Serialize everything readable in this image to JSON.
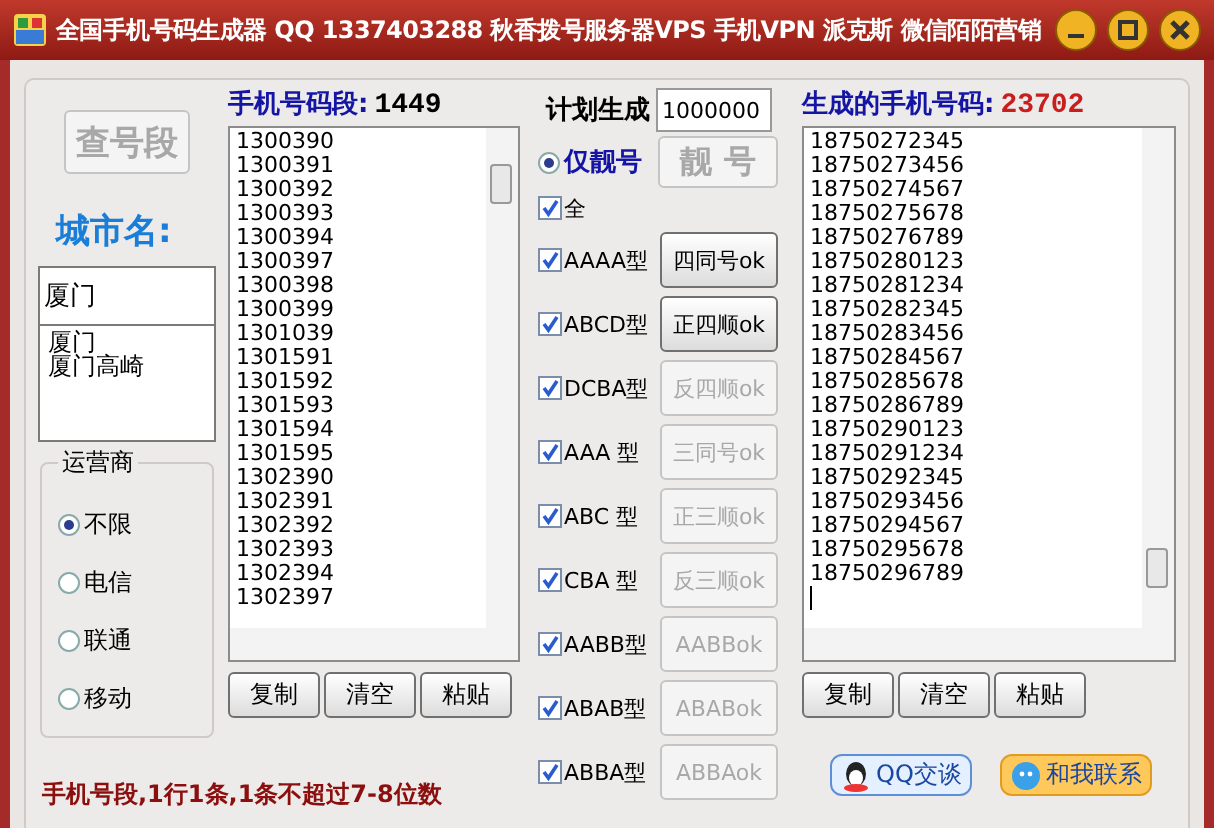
{
  "window": {
    "title": "全国手机号码生成器 QQ 1337403288 秋香拨号服务器VPS 手机VPN 派克斯 微信陌陌营销"
  },
  "lookup_button": {
    "label": "查号段",
    "disabled": true
  },
  "city": {
    "label": "城市名:",
    "value": "厦门",
    "suggestions": [
      "厦门",
      "厦门高崎"
    ]
  },
  "carrier": {
    "title": "运营商",
    "options": [
      {
        "label": "不限",
        "selected": true
      },
      {
        "label": "电信",
        "selected": false
      },
      {
        "label": "联通",
        "selected": false
      },
      {
        "label": "移动",
        "selected": false
      }
    ]
  },
  "segments": {
    "label": "手机号码段:",
    "count": "1449",
    "items": [
      "1300390",
      "1300391",
      "1300392",
      "1300393",
      "1300394",
      "1300397",
      "1300398",
      "1300399",
      "1301039",
      "1301591",
      "1301592",
      "1301593",
      "1301594",
      "1301595",
      "1302390",
      "1302391",
      "1302392",
      "1302393",
      "1302394",
      "1302397"
    ],
    "buttons": [
      "复制",
      "清空",
      "粘贴"
    ]
  },
  "note": "手机号段,1行1条,1条不超过7-8位数",
  "plan": {
    "label": "计划生成",
    "value": "1000000"
  },
  "pretty_only": {
    "label": "仅靓号",
    "selected": true
  },
  "pretty_button": {
    "label": "靓 号",
    "disabled": true
  },
  "patterns": [
    {
      "label": "全",
      "checked": true
    },
    {
      "label": "AAAA型",
      "checked": true,
      "button": {
        "label": "四同号ok",
        "disabled": false
      }
    },
    {
      "label": "ABCD型",
      "checked": true,
      "button": {
        "label": "正四顺ok",
        "disabled": false
      }
    },
    {
      "label": "DCBA型",
      "checked": true,
      "button": {
        "label": "反四顺ok",
        "disabled": true
      }
    },
    {
      "label": "AAA 型",
      "checked": true,
      "button": {
        "label": "三同号ok",
        "disabled": true
      }
    },
    {
      "label": "ABC 型",
      "checked": true,
      "button": {
        "label": "正三顺ok",
        "disabled": true
      }
    },
    {
      "label": "CBA 型",
      "checked": true,
      "button": {
        "label": "反三顺ok",
        "disabled": true
      }
    },
    {
      "label": "AABB型",
      "checked": true,
      "button": {
        "label": "AABBok",
        "disabled": true
      }
    },
    {
      "label": "ABAB型",
      "checked": true,
      "button": {
        "label": "ABABok",
        "disabled": true
      }
    },
    {
      "label": "ABBA型",
      "checked": true,
      "button": {
        "label": "ABBAok",
        "disabled": true
      }
    }
  ],
  "generated": {
    "label": "生成的手机号码:",
    "count": "23702",
    "items": [
      "18750272345",
      "18750273456",
      "18750274567",
      "18750275678",
      "18750276789",
      "18750280123",
      "18750281234",
      "18750282345",
      "18750283456",
      "18750284567",
      "18750285678",
      "18750286789",
      "18750290123",
      "18750291234",
      "18750292345",
      "18750293456",
      "18750294567",
      "18750295678",
      "18750296789"
    ],
    "buttons": [
      "复制",
      "清空",
      "粘贴"
    ]
  },
  "links": [
    "QQ交谈",
    "和我联系"
  ]
}
